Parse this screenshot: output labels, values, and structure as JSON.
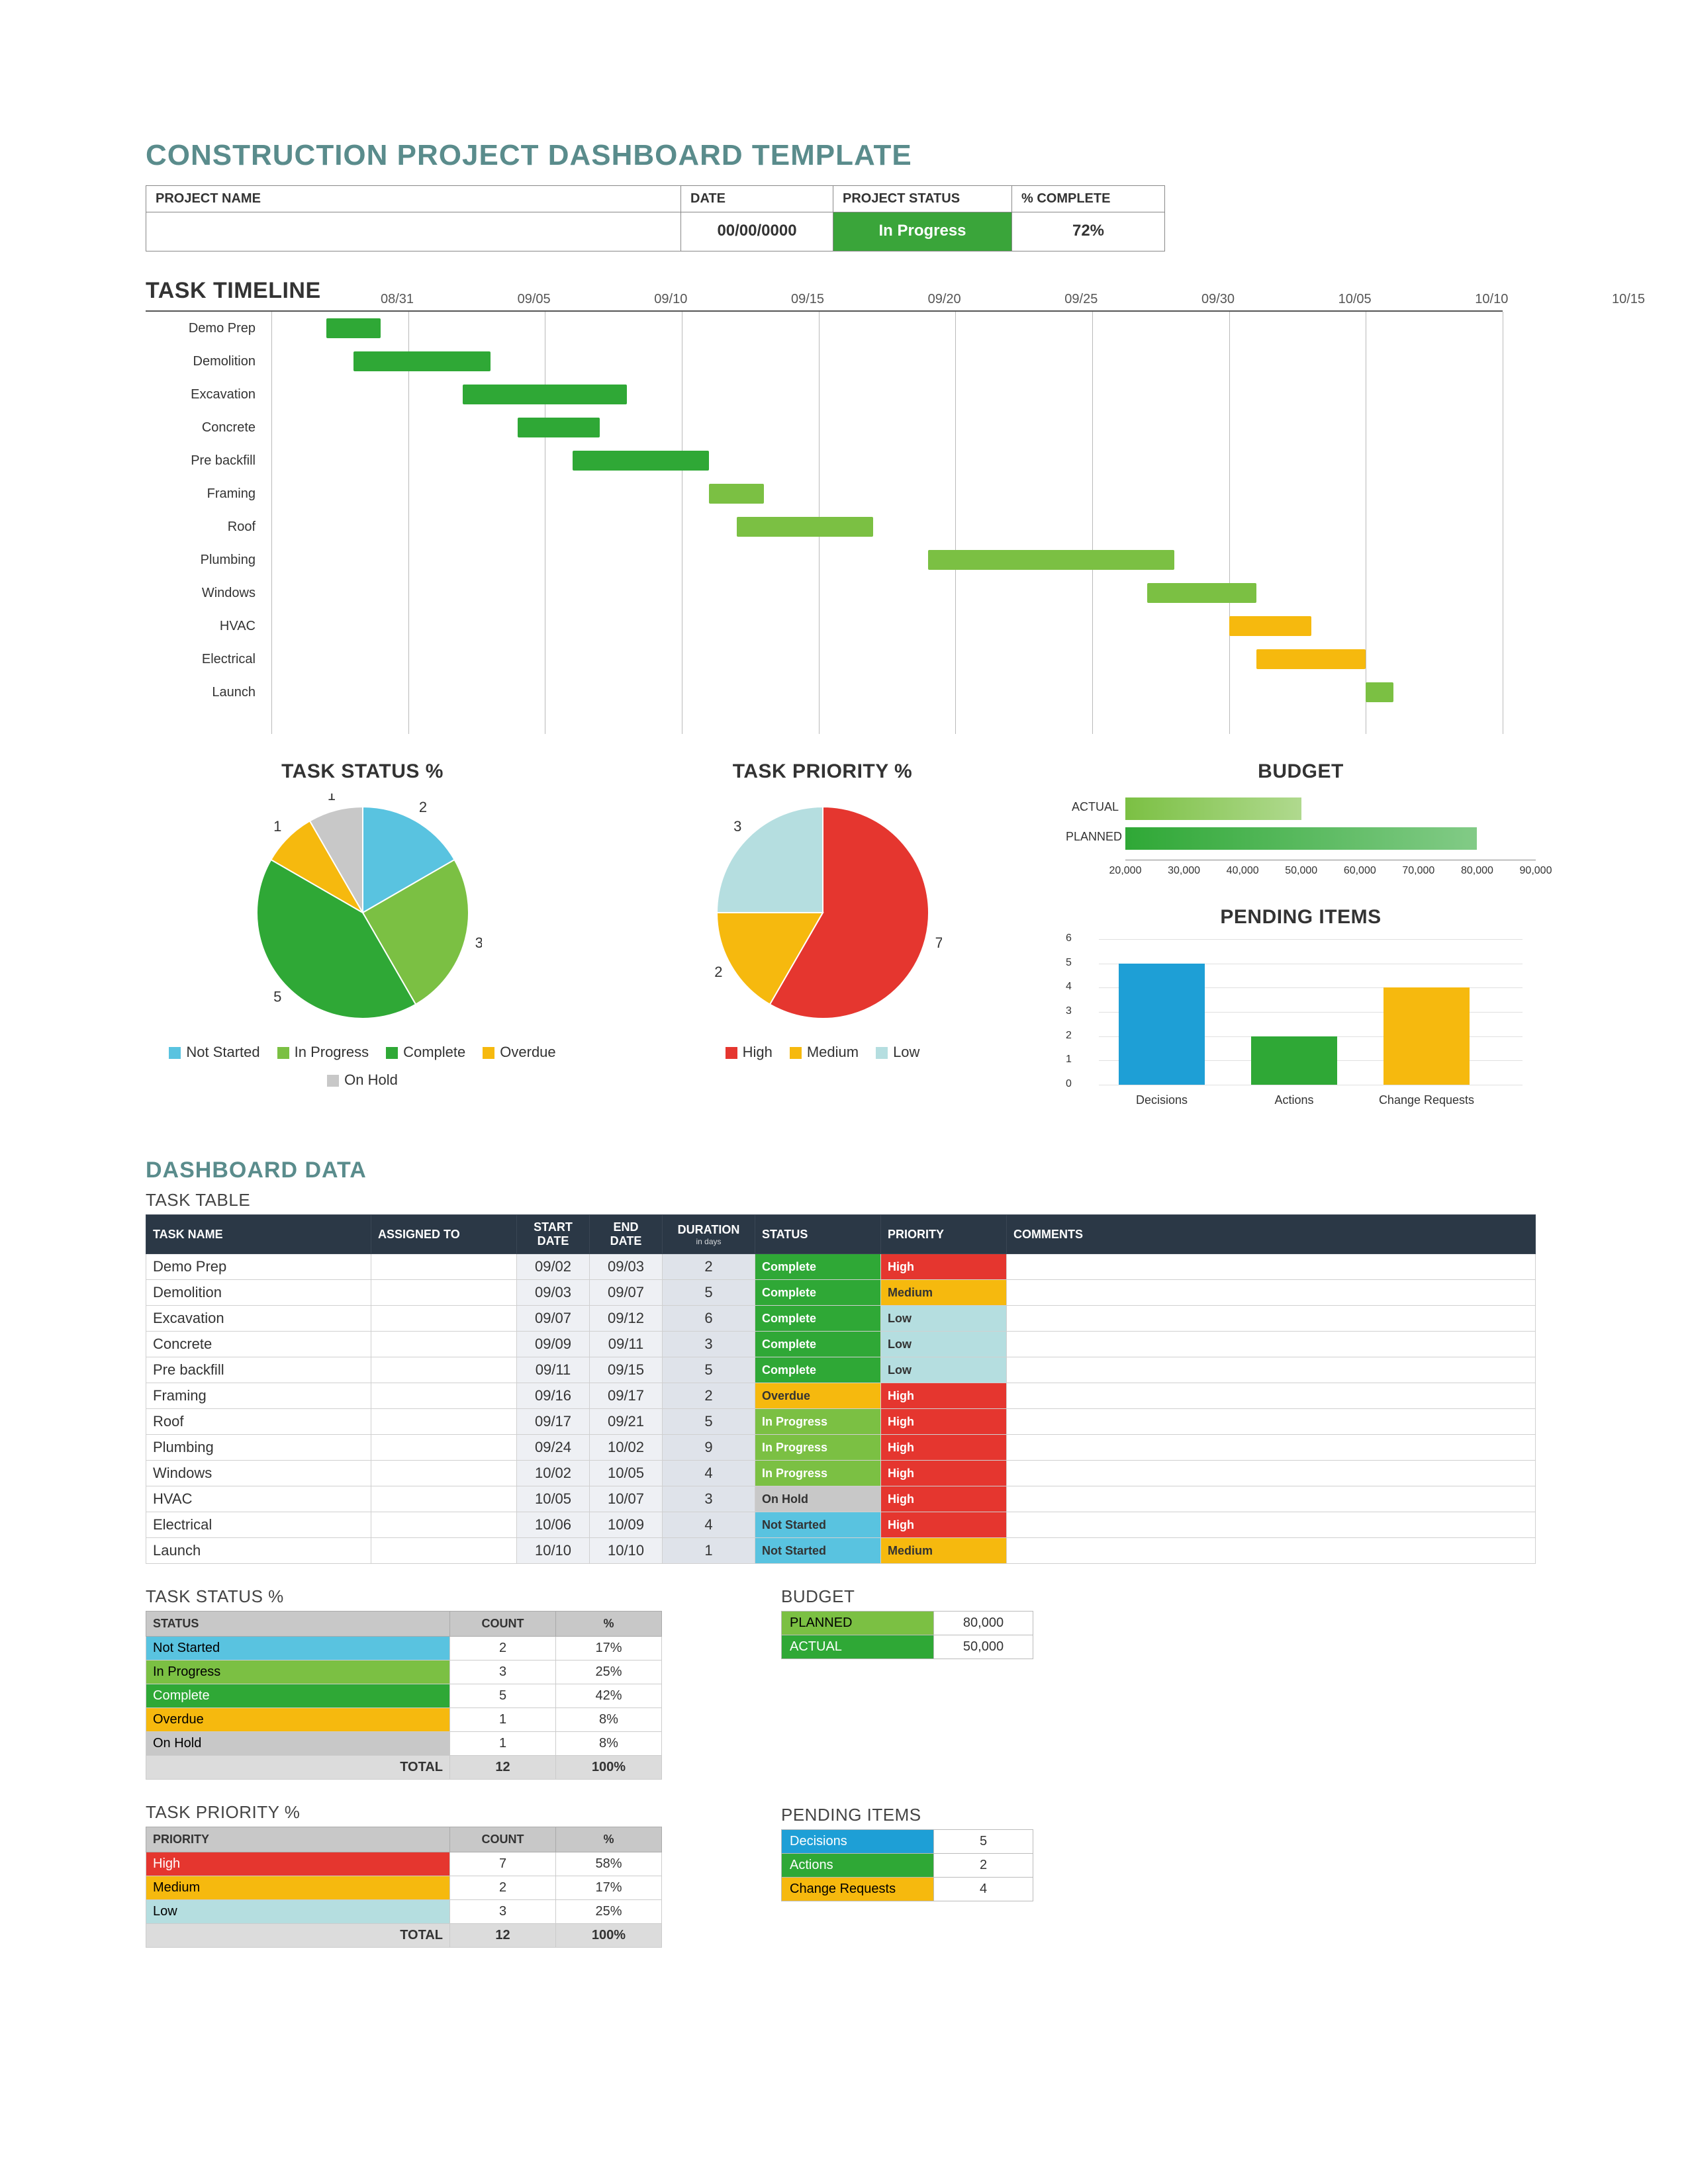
{
  "page_title": "CONSTRUCTION PROJECT DASHBOARD TEMPLATE",
  "info": {
    "project_name_label": "PROJECT NAME",
    "project_name": "",
    "date_label": "DATE",
    "date": "00/00/0000",
    "status_label": "PROJECT STATUS",
    "status": "In Progress",
    "status_color": "#3aa53a",
    "pct_label": "% COMPLETE",
    "pct": "72%"
  },
  "sections": {
    "timeline": "TASK TIMELINE",
    "dashboard_data": "DASHBOARD DATA",
    "task_table": "TASK TABLE",
    "task_status": "TASK STATUS %",
    "task_priority": "TASK PRIORITY %",
    "budget": "BUDGET",
    "pending": "PENDING ITEMS"
  },
  "gantt": {
    "start": "2023-08-31",
    "end": "2023-10-15",
    "range_days": 45,
    "ticks": [
      "08/31",
      "09/05",
      "09/10",
      "09/15",
      "09/20",
      "09/25",
      "09/30",
      "10/05",
      "10/10",
      "10/15"
    ],
    "tasks": [
      {
        "name": "Demo Prep",
        "start": 2,
        "dur": 2,
        "color": "#2fa836"
      },
      {
        "name": "Demolition",
        "start": 3,
        "dur": 5,
        "color": "#2fa836"
      },
      {
        "name": "Excavation",
        "start": 7,
        "dur": 6,
        "color": "#2fa836"
      },
      {
        "name": "Concrete",
        "start": 9,
        "dur": 3,
        "color": "#2fa836"
      },
      {
        "name": "Pre backfill",
        "start": 11,
        "dur": 5,
        "color": "#2fa836"
      },
      {
        "name": "Framing",
        "start": 16,
        "dur": 2,
        "color": "#7bc043"
      },
      {
        "name": "Roof",
        "start": 17,
        "dur": 5,
        "color": "#7bc043"
      },
      {
        "name": "Plumbing",
        "start": 24,
        "dur": 9,
        "color": "#7bc043"
      },
      {
        "name": "Windows",
        "start": 32,
        "dur": 4,
        "color": "#7bc043"
      },
      {
        "name": "HVAC",
        "start": 35,
        "dur": 3,
        "color": "#f6b90e"
      },
      {
        "name": "Electrical",
        "start": 36,
        "dur": 4,
        "color": "#f6b90e"
      },
      {
        "name": "Launch",
        "start": 40,
        "dur": 1,
        "color": "#7bc043"
      }
    ]
  },
  "chart_data": [
    {
      "id": "task_status_pie",
      "type": "pie",
      "title": "TASK STATUS %",
      "series": [
        {
          "name": "Not Started",
          "value": 2,
          "color": "#59c3e0"
        },
        {
          "name": "In Progress",
          "value": 3,
          "color": "#7bc043"
        },
        {
          "name": "Complete",
          "value": 5,
          "color": "#2fa836"
        },
        {
          "name": "Overdue",
          "value": 1,
          "color": "#f6b90e"
        },
        {
          "name": "On Hold",
          "value": 1,
          "color": "#c8c8c8"
        }
      ],
      "total": 12
    },
    {
      "id": "task_priority_pie",
      "type": "pie",
      "title": "TASK PRIORITY %",
      "series": [
        {
          "name": "High",
          "value": 7,
          "color": "#e5362f"
        },
        {
          "name": "Medium",
          "value": 2,
          "color": "#f6b90e"
        },
        {
          "name": "Low",
          "value": 3,
          "color": "#b5dee0"
        }
      ],
      "total": 12
    },
    {
      "id": "budget_bar",
      "type": "bar",
      "title": "BUDGET",
      "orientation": "horizontal",
      "categories": [
        "ACTUAL",
        "PLANNED"
      ],
      "values": [
        50000,
        80000
      ],
      "xlim": [
        20000,
        90000
      ],
      "ticks": [
        "20,000",
        "30,000",
        "40,000",
        "50,000",
        "60,000",
        "70,000",
        "80,000",
        "90,000"
      ],
      "colors": [
        "#7bc043",
        "#2fa836"
      ]
    },
    {
      "id": "pending_bar",
      "type": "bar",
      "title": "PENDING ITEMS",
      "categories": [
        "Decisions",
        "Actions",
        "Change Requests"
      ],
      "values": [
        5,
        2,
        4
      ],
      "ylim": [
        0,
        6
      ],
      "yticks": [
        0,
        1,
        2,
        3,
        4,
        5,
        6
      ],
      "colors": [
        "#1e9fd6",
        "#2fa836",
        "#f6b90e"
      ]
    }
  ],
  "task_table": {
    "headers": [
      "TASK NAME",
      "ASSIGNED TO",
      "START DATE",
      "END DATE",
      "DURATION",
      "STATUS",
      "PRIORITY",
      "COMMENTS"
    ],
    "duration_sub": "in days",
    "rows": [
      {
        "name": "Demo Prep",
        "assigned": "",
        "start": "09/02",
        "end": "09/03",
        "dur": "2",
        "status": "Complete",
        "priority": "High",
        "comments": ""
      },
      {
        "name": "Demolition",
        "assigned": "",
        "start": "09/03",
        "end": "09/07",
        "dur": "5",
        "status": "Complete",
        "priority": "Medium",
        "comments": ""
      },
      {
        "name": "Excavation",
        "assigned": "",
        "start": "09/07",
        "end": "09/12",
        "dur": "6",
        "status": "Complete",
        "priority": "Low",
        "comments": ""
      },
      {
        "name": "Concrete",
        "assigned": "",
        "start": "09/09",
        "end": "09/11",
        "dur": "3",
        "status": "Complete",
        "priority": "Low",
        "comments": ""
      },
      {
        "name": "Pre backfill",
        "assigned": "",
        "start": "09/11",
        "end": "09/15",
        "dur": "5",
        "status": "Complete",
        "priority": "Low",
        "comments": ""
      },
      {
        "name": "Framing",
        "assigned": "",
        "start": "09/16",
        "end": "09/17",
        "dur": "2",
        "status": "Overdue",
        "priority": "High",
        "comments": ""
      },
      {
        "name": "Roof",
        "assigned": "",
        "start": "09/17",
        "end": "09/21",
        "dur": "5",
        "status": "In Progress",
        "priority": "High",
        "comments": ""
      },
      {
        "name": "Plumbing",
        "assigned": "",
        "start": "09/24",
        "end": "10/02",
        "dur": "9",
        "status": "In Progress",
        "priority": "High",
        "comments": ""
      },
      {
        "name": "Windows",
        "assigned": "",
        "start": "10/02",
        "end": "10/05",
        "dur": "4",
        "status": "In Progress",
        "priority": "High",
        "comments": ""
      },
      {
        "name": "HVAC",
        "assigned": "",
        "start": "10/05",
        "end": "10/07",
        "dur": "3",
        "status": "On Hold",
        "priority": "High",
        "comments": ""
      },
      {
        "name": "Electrical",
        "assigned": "",
        "start": "10/06",
        "end": "10/09",
        "dur": "4",
        "status": "Not Started",
        "priority": "High",
        "comments": ""
      },
      {
        "name": "Launch",
        "assigned": "",
        "start": "10/10",
        "end": "10/10",
        "dur": "1",
        "status": "Not Started",
        "priority": "Medium",
        "comments": ""
      }
    ]
  },
  "status_summary": {
    "headers": [
      "STATUS",
      "COUNT",
      "%"
    ],
    "rows": [
      {
        "label": "Not Started",
        "count": "2",
        "pct": "17%",
        "bg": "#59c3e0"
      },
      {
        "label": "In Progress",
        "count": "3",
        "pct": "25%",
        "bg": "#7bc043"
      },
      {
        "label": "Complete",
        "count": "5",
        "pct": "42%",
        "bg": "#2fa836",
        "fg": "#fff"
      },
      {
        "label": "Overdue",
        "count": "1",
        "pct": "8%",
        "bg": "#f6b90e"
      },
      {
        "label": "On Hold",
        "count": "1",
        "pct": "8%",
        "bg": "#c8c8c8"
      }
    ],
    "total_label": "TOTAL",
    "total_count": "12",
    "total_pct": "100%"
  },
  "priority_summary": {
    "headers": [
      "PRIORITY",
      "COUNT",
      "%"
    ],
    "rows": [
      {
        "label": "High",
        "count": "7",
        "pct": "58%",
        "bg": "#e5362f",
        "fg": "#fff"
      },
      {
        "label": "Medium",
        "count": "2",
        "pct": "17%",
        "bg": "#f6b90e"
      },
      {
        "label": "Low",
        "count": "3",
        "pct": "25%",
        "bg": "#b5dee0"
      }
    ],
    "total_label": "TOTAL",
    "total_count": "12",
    "total_pct": "100%"
  },
  "budget_summary": {
    "rows": [
      {
        "label": "PLANNED",
        "value": "80,000",
        "bg": "#7bc043"
      },
      {
        "label": "ACTUAL",
        "value": "50,000",
        "bg": "#2fa836",
        "fg": "#fff"
      }
    ]
  },
  "pending_summary": {
    "rows": [
      {
        "label": "Decisions",
        "value": "5",
        "bg": "#1e9fd6",
        "fg": "#fff"
      },
      {
        "label": "Actions",
        "value": "2",
        "bg": "#2fa836",
        "fg": "#fff"
      },
      {
        "label": "Change Requests",
        "value": "4",
        "bg": "#f6b90e"
      }
    ]
  },
  "status_bg": {
    "Complete": "bg-complete",
    "In Progress": "bg-inprog",
    "Overdue": "bg-overdue",
    "On Hold": "bg-hold",
    "Not Started": "bg-notstart"
  },
  "prio_bg": {
    "High": "bg-high",
    "Medium": "bg-med",
    "Low": "bg-low"
  }
}
